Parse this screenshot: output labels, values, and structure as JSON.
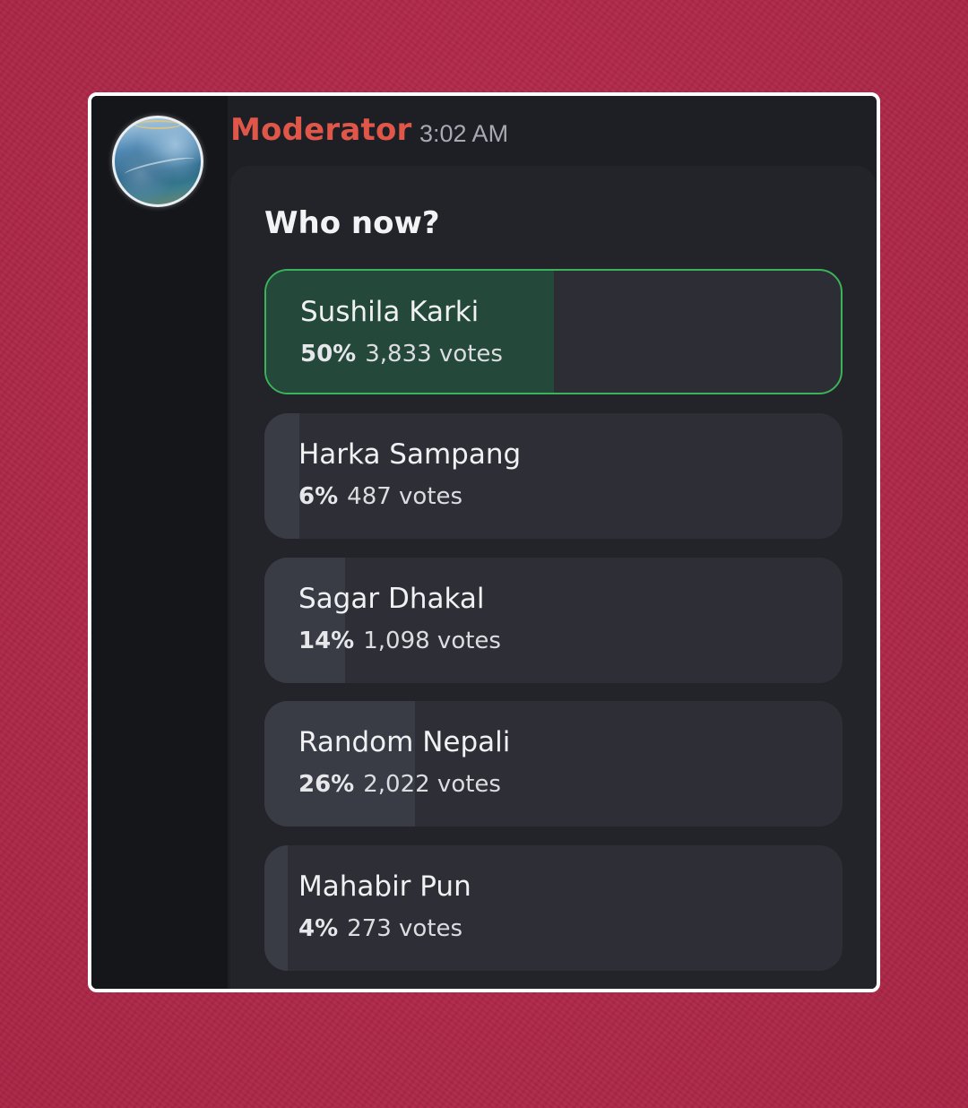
{
  "message": {
    "author": "Moderator",
    "timestamp": "3:02 AM",
    "author_color": "#e0574a"
  },
  "poll": {
    "question": "Who now?",
    "options": [
      {
        "name": "Sushila Karki",
        "percent_label": "50%",
        "votes_label": "3,833 votes",
        "percent": 50,
        "votes": 3833,
        "leading": true
      },
      {
        "name": "Harka Sampang",
        "percent_label": "6%",
        "votes_label": "487 votes",
        "percent": 6,
        "votes": 487,
        "leading": false
      },
      {
        "name": "Sagar Dhakal",
        "percent_label": "14%",
        "votes_label": "1,098 votes",
        "percent": 14,
        "votes": 1098,
        "leading": false
      },
      {
        "name": "Random Nepali",
        "percent_label": "26%",
        "votes_label": "2,022 votes",
        "percent": 26,
        "votes": 2022,
        "leading": false
      },
      {
        "name": "Mahabir Pun",
        "percent_label": "4%",
        "votes_label": "273 votes",
        "percent": 4,
        "votes": 273,
        "leading": false
      }
    ]
  },
  "colors": {
    "background": "#b3294a",
    "panel": "#1e1f25",
    "winner_border": "#3bb35a",
    "winner_fill": "#24483a"
  }
}
